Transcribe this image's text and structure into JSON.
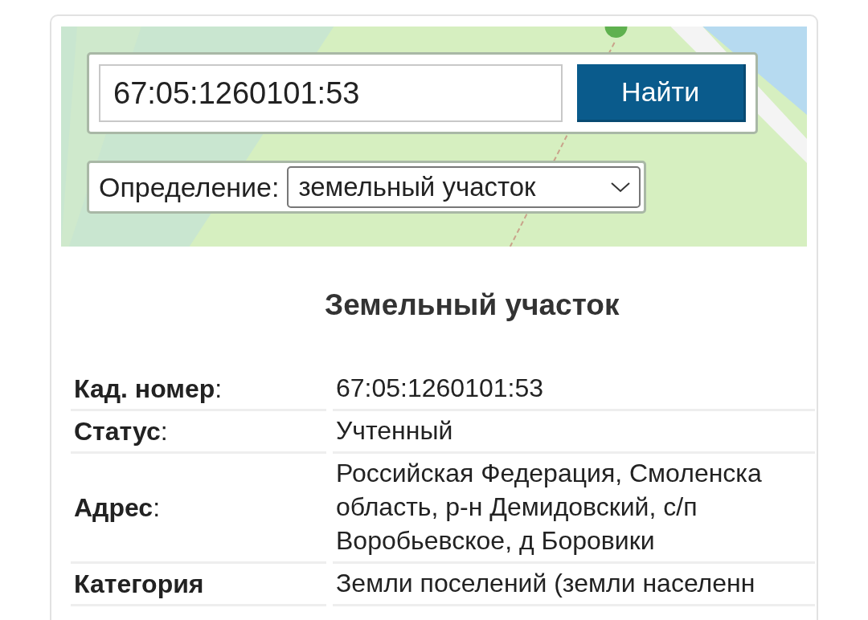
{
  "search": {
    "value": "67:05:1260101:53",
    "button": "Найти"
  },
  "definition": {
    "label": "Определение:",
    "value": "земельный участок"
  },
  "title": "Земельный участок",
  "rows": [
    {
      "label": "**Кад. номер**:",
      "lines": [
        "67:05:1260101:53"
      ]
    },
    {
      "label": "**Статус**:",
      "lines": [
        "Учтенный"
      ]
    },
    {
      "label": "**Адрес**:",
      "lines": [
        "Российская Федерация, Смоленска",
        "область, р-н Демидовский, с/п",
        "Воробьевское, д Боровики"
      ]
    },
    {
      "label": "**Категория**",
      "lines": [
        "Земли поселений (земли населенн"
      ]
    }
  ]
}
